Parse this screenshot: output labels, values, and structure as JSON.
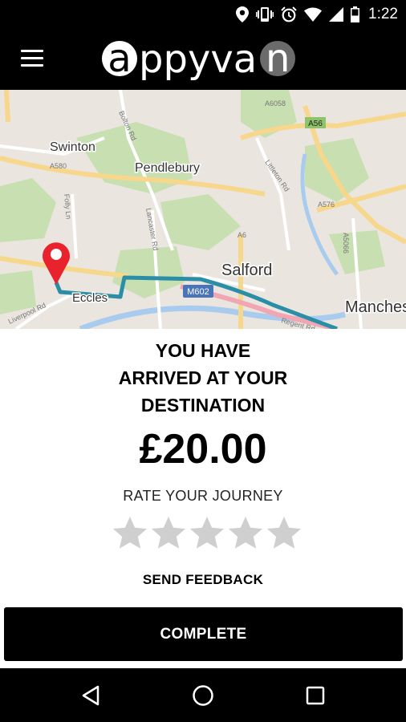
{
  "status_bar": {
    "time": "1:22",
    "icons": [
      "location-icon",
      "vibrate-icon",
      "alarm-icon",
      "wifi-icon",
      "signal-icon",
      "battery-icon"
    ]
  },
  "app_bar": {
    "menu_icon": "hamburger-menu-icon",
    "logo": {
      "first": "a",
      "middle": "ppyva",
      "last": "n"
    }
  },
  "map": {
    "labels": {
      "swinton": "Swinton",
      "pendlebury": "Pendlebury",
      "salford": "Salford",
      "eccles": "Eccles",
      "manchester": "Manches",
      "m602": "M602",
      "a56": "A56",
      "a580": "A580",
      "a576": "A576",
      "bolton_rd": "Bolton Rd",
      "lancaster_rd": "Lancaster Rd",
      "folly_ln": "Folly Ln",
      "liverpool_rd": "Liverpool Rd",
      "regent_rd": "Regent Rd",
      "littleton_rd": "Littleton Rd",
      "a6": "A6",
      "a6058": "A6058",
      "a5066": "A5066"
    },
    "colors": {
      "route": "#2a8fa6",
      "pin": "#e8232d"
    }
  },
  "summary": {
    "line1": "YOU HAVE",
    "line2": "ARRIVED AT YOUR",
    "line3": "DESTINATION",
    "price": "£20.00",
    "rate_label": "RATE YOUR JOURNEY",
    "rating": 0,
    "rating_max": 5,
    "feedback": "SEND FEEDBACK",
    "complete": "COMPLETE"
  },
  "nav_bar": {
    "back_icon": "back-triangle-icon",
    "home_icon": "home-circle-icon",
    "recents_icon": "recents-square-icon"
  }
}
